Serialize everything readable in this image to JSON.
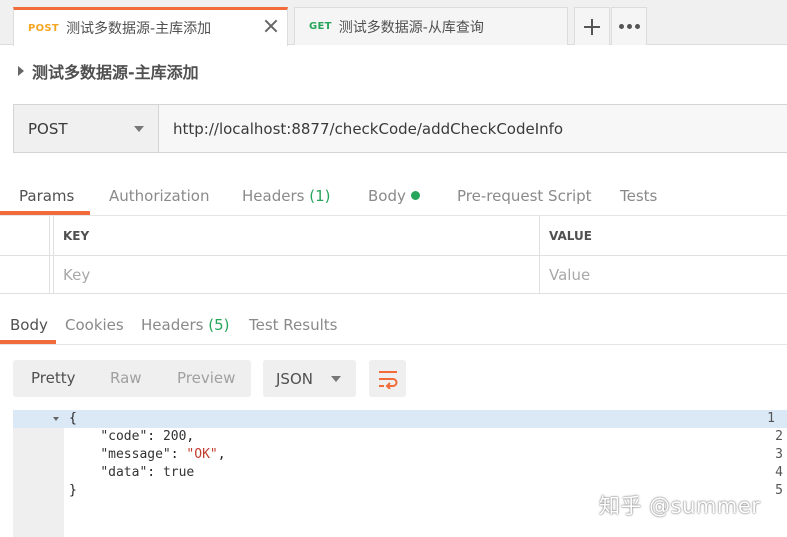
{
  "tabs": [
    {
      "method": "POST",
      "title": "测试多数据源-主库添加",
      "active": true
    },
    {
      "method": "GET",
      "title": "测试多数据源-从库查询",
      "active": false
    }
  ],
  "request": {
    "title": "测试多数据源-主库添加",
    "method": "POST",
    "url": "http://localhost:8877/checkCode/addCheckCodeInfo"
  },
  "request_tabs": {
    "params": "Params",
    "authorization": "Authorization",
    "headers": "Headers",
    "headers_count": "(1)",
    "body": "Body",
    "prerequest": "Pre-request Script",
    "tests": "Tests"
  },
  "params_table": {
    "key_header": "KEY",
    "value_header": "VALUE",
    "key_placeholder": "Key",
    "value_placeholder": "Value"
  },
  "response_tabs": {
    "body": "Body",
    "cookies": "Cookies",
    "headers": "Headers",
    "headers_count": "(5)",
    "test_results": "Test Results"
  },
  "response_toolbar": {
    "pretty": "Pretty",
    "raw": "Raw",
    "preview": "Preview",
    "format": "JSON"
  },
  "response_body": {
    "line_numbers": [
      "1",
      "2",
      "3",
      "4",
      "5"
    ],
    "open_brace": "{",
    "close_brace": "}",
    "code_key": "\"code\"",
    "code_value": "200",
    "message_key": "\"message\"",
    "message_value": "\"OK\"",
    "data_key": "\"data\"",
    "data_value": "true"
  },
  "watermark": "知乎 @summer",
  "colors": {
    "accent": "#f26b3a",
    "post": "#f5a623",
    "get": "#26a65b",
    "count_green": "#26a65b",
    "string_red": "#c23c2f"
  }
}
